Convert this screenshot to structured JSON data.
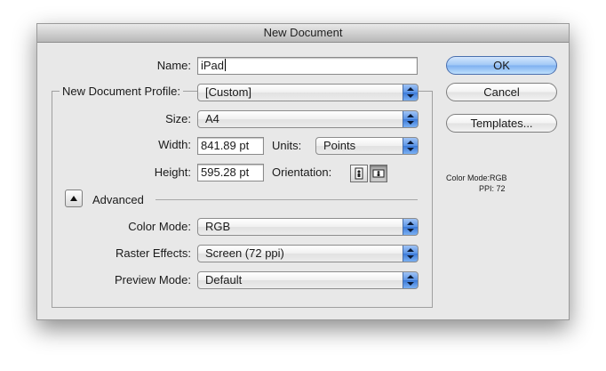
{
  "window": {
    "title": "New Document"
  },
  "form": {
    "name_label": "Name:",
    "name_value": "iPad",
    "profile_label": "New Document Profile:",
    "profile_value": "[Custom]",
    "size_label": "Size:",
    "size_value": "A4",
    "width_label": "Width:",
    "width_value": "841.89 pt",
    "units_label": "Units:",
    "units_value": "Points",
    "height_label": "Height:",
    "height_value": "595.28 pt",
    "orientation_label": "Orientation:",
    "orientation_selected": "landscape",
    "advanced_label": "Advanced",
    "color_mode_label": "Color Mode:",
    "color_mode_value": "RGB",
    "raster_label": "Raster Effects:",
    "raster_value": "Screen (72 ppi)",
    "preview_label": "Preview Mode:",
    "preview_value": "Default"
  },
  "buttons": {
    "ok": "OK",
    "cancel": "Cancel",
    "templates": "Templates..."
  },
  "info": {
    "color_mode": "Color Mode:RGB",
    "ppi": "PPI: 72"
  },
  "colors": {
    "accent": "#5b94e6",
    "dialog_bg": "#e8e8e8"
  },
  "icons": [
    "chevron-up-down-icon",
    "portrait-orientation-icon",
    "landscape-orientation-icon",
    "disclosure-triangle-icon"
  ]
}
